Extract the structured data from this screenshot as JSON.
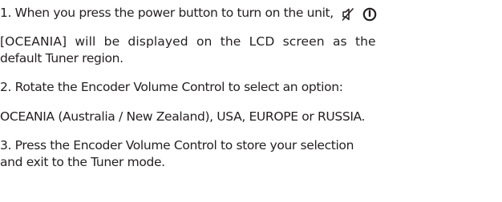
{
  "instructions": {
    "step1": {
      "text": "1. When you press the power button to turn on the unit,",
      "icons": [
        "mute-speaker-icon",
        "power-icon"
      ]
    },
    "step1_detail_line1": "[OCEANIA] will be displayed on the LCD screen as the",
    "step1_detail_line2": "default Tuner region.",
    "step2": "2. Rotate the Encoder Volume Control to select an option:",
    "step2_options": "OCEANIA (Australia / New Zealand), USA, EUROPE or RUSSIA.",
    "step3_line1": "3. Press the Encoder Volume Control to store your selection",
    "step3_line2": "and exit to the Tuner mode."
  }
}
